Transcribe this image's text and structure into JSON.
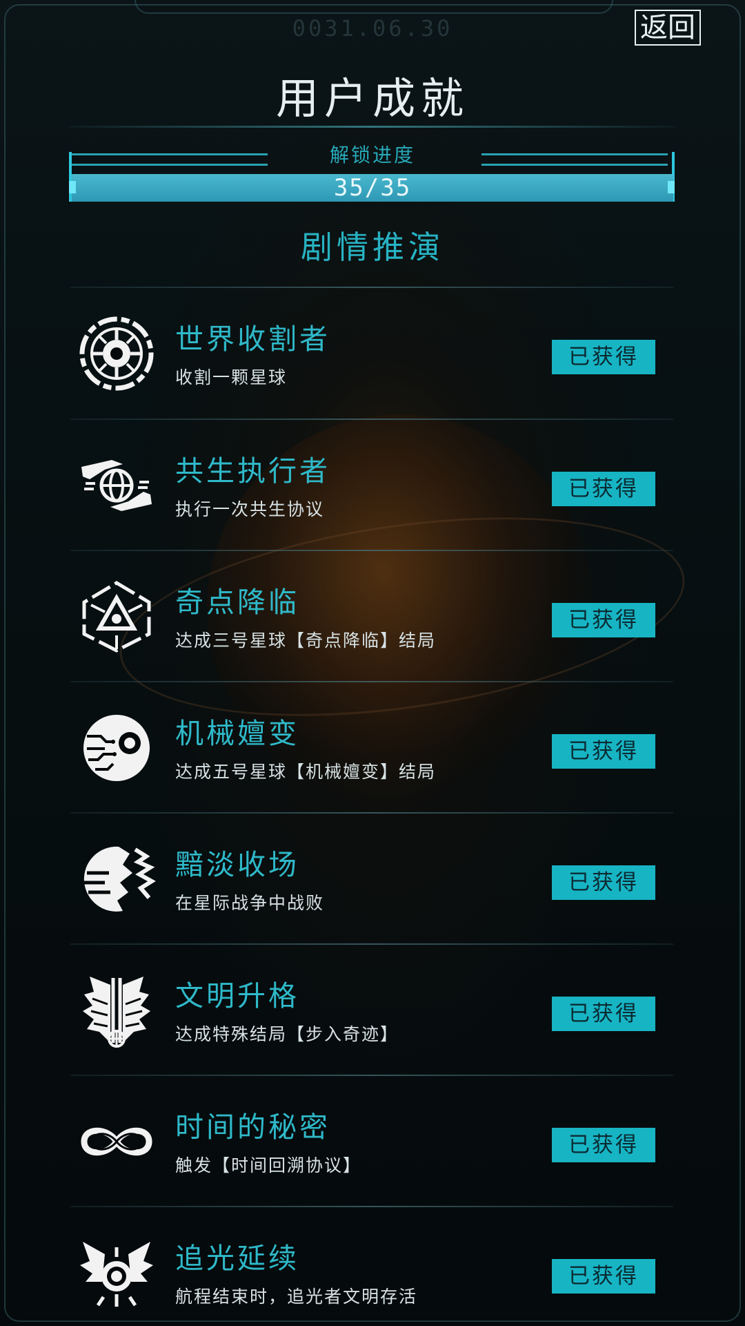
{
  "header": {
    "date": "0031.06.30",
    "back_label": "返回",
    "title": "用户成就"
  },
  "progress": {
    "label": "解锁进度",
    "text": "35/35",
    "unlocked": 35,
    "total": 35,
    "fill_fraction": 1.0
  },
  "section": {
    "title": "剧情推演"
  },
  "colors": {
    "accent": "#27b3c3",
    "badge_bg": "#17b4c4",
    "background": "#05090b"
  },
  "achievements": [
    {
      "name": "世界收割者",
      "desc": "收割一颗星球",
      "status": "已获得",
      "icon": "planet-harvester-icon"
    },
    {
      "name": "共生执行者",
      "desc": "执行一次共生协议",
      "status": "已获得",
      "icon": "hands-globe-icon"
    },
    {
      "name": "奇点降临",
      "desc": "达成三号星球【奇点降临】结局",
      "status": "已获得",
      "icon": "singularity-triangle-icon"
    },
    {
      "name": "机械嬗变",
      "desc": "达成五号星球【机械嬗变】结局",
      "status": "已获得",
      "icon": "mechanical-eye-icon"
    },
    {
      "name": "黯淡收场",
      "desc": "在星际战争中战败",
      "status": "已获得",
      "icon": "shattered-planet-icon"
    },
    {
      "name": "文明升格",
      "desc": "达成特殊结局【步入奇迹】",
      "status": "已获得",
      "icon": "winged-emblem-icon"
    },
    {
      "name": "时间的秘密",
      "desc": "触发【时间回溯协议】",
      "status": "已获得",
      "icon": "infinity-icon"
    },
    {
      "name": "追光延续",
      "desc": "航程结束时，追光者文明存活",
      "status": "已获得",
      "icon": "winged-sun-icon"
    }
  ]
}
